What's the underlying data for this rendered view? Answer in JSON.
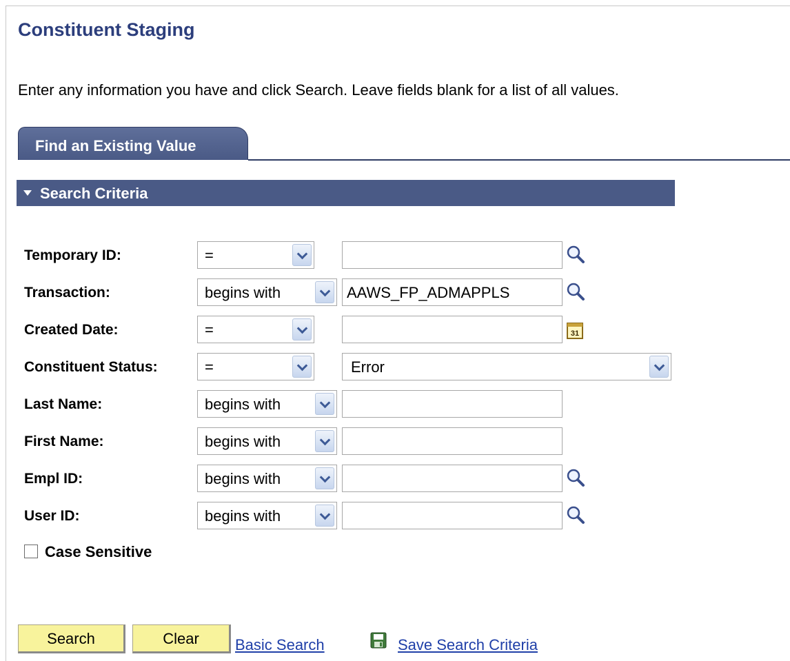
{
  "page": {
    "title": "Constituent Staging",
    "instructions": "Enter any information you have and click Search. Leave fields blank for a list of all values."
  },
  "tab": {
    "label": "Find an Existing Value"
  },
  "section": {
    "label": "Search Criteria"
  },
  "criteria": [
    {
      "label": "Temporary ID:",
      "operator": "=",
      "value": "",
      "icon": "lookup-icon"
    },
    {
      "label": "Transaction:",
      "operator": "begins with",
      "value": "AAWS_FP_ADMAPPLS",
      "icon": "lookup-icon"
    },
    {
      "label": "Created Date:",
      "operator": "=",
      "value": "",
      "icon": "calendar-icon",
      "icon_text": "31"
    },
    {
      "label": "Constituent Status:",
      "operator": "=",
      "value": "Error"
    },
    {
      "label": "Last Name:",
      "operator": "begins with",
      "value": ""
    },
    {
      "label": "First Name:",
      "operator": "begins with",
      "value": ""
    },
    {
      "label": "Empl ID:",
      "operator": "begins with",
      "value": "",
      "icon": "lookup-icon"
    },
    {
      "label": "User ID:",
      "operator": "begins with",
      "value": "",
      "icon": "lookup-icon"
    }
  ],
  "case_sensitive": {
    "label": "Case Sensitive",
    "checked": false
  },
  "actions": {
    "search": "Search",
    "clear": "Clear",
    "basic_search": "Basic Search",
    "save_criteria": "Save Search Criteria"
  },
  "colors": {
    "title": "#2c3e7c",
    "bar": "#4a5a86",
    "button": "#f8f39c",
    "link": "#1f3fa8"
  }
}
